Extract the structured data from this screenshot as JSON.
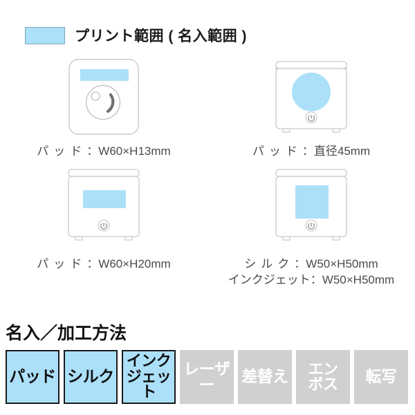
{
  "legend": {
    "swatch_color": "#ace0f9",
    "label": "プリント範囲 ( 名入範囲 )"
  },
  "products": [
    {
      "view": "top-view-square",
      "print_area_shape": "rectangle",
      "caption_prefix": "パッド",
      "caption_value": "：W60×H13mm"
    },
    {
      "view": "front-view",
      "print_area_shape": "circle",
      "caption_prefix": "パッド",
      "caption_value": "：直径45mm"
    },
    {
      "view": "front-view",
      "print_area_shape": "wide-rectangle",
      "caption_prefix": "パッド",
      "caption_value": "：W60×H20mm"
    },
    {
      "view": "front-view",
      "print_area_shape": "square",
      "caption_prefix": "シルク",
      "caption_value": "：W50×H50mm",
      "caption_prefix2": "インクジェット",
      "caption_value2": "：W50×H50mm"
    }
  ],
  "methods_section": {
    "title": "名入／加工方法",
    "active_bg": "#ace0f9",
    "inactive_bg": "#d0d0d0",
    "items": [
      {
        "label": "パッド",
        "line1": "パッド",
        "line2": "",
        "active": true
      },
      {
        "label": "シルク",
        "line1": "シルク",
        "line2": "",
        "active": true
      },
      {
        "label": "インクジェット",
        "line1": "インク",
        "line2": "ジェット",
        "active": true
      },
      {
        "label": "レーザー",
        "line1": "レーザー",
        "line2": "",
        "active": false
      },
      {
        "label": "差替え",
        "line1": "差替え",
        "line2": "",
        "active": false
      },
      {
        "label": "エンボス",
        "line1": "エン",
        "line2": "ボス",
        "active": false
      },
      {
        "label": "転写",
        "line1": "転写",
        "line2": "",
        "active": false
      }
    ]
  }
}
